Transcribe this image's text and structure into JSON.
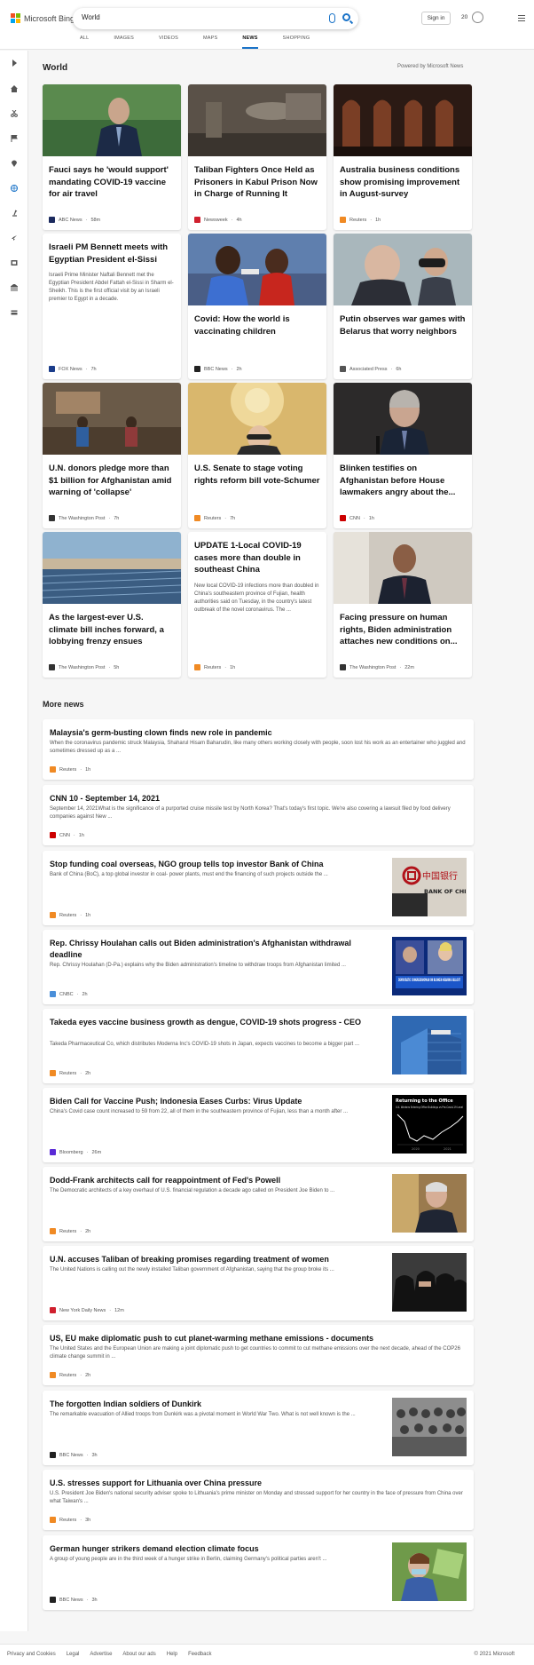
{
  "header": {
    "logo_text": "Microsoft Bing",
    "search_value": "World",
    "signin_label": "Sign in",
    "rewards_count": "20",
    "tabs": [
      "ALL",
      "IMAGES",
      "VIDEOS",
      "MAPS",
      "NEWS",
      "SHOPPING"
    ],
    "active_tab": "NEWS"
  },
  "section": {
    "title": "World",
    "powered_by": "Powered by Microsoft News"
  },
  "cards": [
    {
      "title": "Fauci says he 'would support' mandating COVID-19 vaccine for air travel",
      "desc": "",
      "source": "ABC News",
      "time": "58m",
      "logo_color": "#1b2a5e"
    },
    {
      "title": "Taliban Fighters Once Held as Prisoners in Kabul Prison Now in Charge of Running It",
      "desc": "",
      "source": "Newsweek",
      "time": "4h",
      "logo_color": "#d0202e"
    },
    {
      "title": "Australia business conditions show promising improvement in August-survey",
      "desc": "",
      "source": "Reuters",
      "time": "1h",
      "logo_color": "#f08a24"
    },
    {
      "title": "Israeli PM Bennett meets with Egyptian President el-Sissi",
      "desc": "Israeli Prime Minister Naftali Bennett met the Egyptian President Abdel Fattah el-Sissi in Sharm el-Sheikh. This is the first official visit by an Israeli premier to Egypt in a decade.",
      "source": "FOX News",
      "time": "7h",
      "logo_color": "#1a3c8a"
    },
    {
      "title": "Covid: How the world is vaccinating children",
      "desc": "",
      "source": "BBC News",
      "time": "2h",
      "logo_color": "#222222"
    },
    {
      "title": "Putin observes war games with Belarus that worry neighbors",
      "desc": "",
      "source": "Associated Press",
      "time": "6h",
      "logo_color": "#555555"
    },
    {
      "title": "U.N. donors pledge more than $1 billion for Afghanistan amid warning of 'collapse'",
      "desc": "",
      "source": "The Washington Post",
      "time": "7h",
      "logo_color": "#333333"
    },
    {
      "title": "U.S. Senate to stage voting rights reform bill vote-Schumer",
      "desc": "",
      "source": "Reuters",
      "time": "7h",
      "logo_color": "#f08a24"
    },
    {
      "title": "Blinken testifies on Afghanistan before House lawmakers angry about the...",
      "desc": "",
      "source": "CNN",
      "time": "1h",
      "logo_color": "#cc0000"
    },
    {
      "title": "As the largest-ever U.S. climate bill inches forward, a lobbying frenzy ensues",
      "desc": "",
      "source": "The Washington Post",
      "time": "5h",
      "logo_color": "#333333"
    },
    {
      "title": "UPDATE 1-Local COVID-19 cases more than double in southeast China",
      "desc": "New local COVID-19 infections more than doubled in China's southeastern province of Fujian, health authorities said on Tuesday, in the country's latest outbreak of the novel coronavirus. The ...",
      "source": "Reuters",
      "time": "1h",
      "logo_color": "#f08a24"
    },
    {
      "title": "Facing pressure on human rights, Biden administration attaches new conditions on...",
      "desc": "",
      "source": "The Washington Post",
      "time": "22m",
      "logo_color": "#333333"
    }
  ],
  "more_news": {
    "title": "More news",
    "items": [
      {
        "title": "Malaysia's germ-busting clown finds new role in pandemic",
        "desc": "When the coronavirus pandemic struck Malaysia, Shaharul Hisam Baharudin, like many others working closely with people, soon lost his work as an entertainer who juggled and sometimes dressed up as a ...",
        "source": "Reuters",
        "time": "1h",
        "logo_color": "#f08a24",
        "thumb": ""
      },
      {
        "title": "CNN 10 - September 14, 2021",
        "desc": "September 14, 2021What is the significance of a purported cruise missile test by North Korea? That's today's first topic. We're also covering a lawsuit filed by food delivery companies against New ...",
        "source": "CNN",
        "time": "1h",
        "logo_color": "#cc0000",
        "thumb": ""
      },
      {
        "title": "Stop funding coal overseas, NGO group tells top investor Bank of China",
        "desc": "Bank of China (BoC), a top global investor in coal- power plants, must end the financing of such projects outside the ...",
        "source": "Reuters",
        "time": "1h",
        "logo_color": "#f08a24",
        "thumb": "boc",
        "thumb_cn": "中国银行",
        "thumb_en": "BANK OF CHINA"
      },
      {
        "title": "Rep. Chrissy Houlahan calls out Biden administration's Afghanistan withdrawal deadline",
        "desc": "Rep. Chrissy Houlahan (D-Pa.) explains why the Biden administration's timeline to withdraw troops from Afghanistan limited ...",
        "source": "CNBC",
        "time": "2h",
        "logo_color": "#4a8fd9",
        "thumb": "cnbc",
        "thumb_caption": "DEMOCRATIC CONGRESSWOMAN ON BLINKEN HEARING FALLOUT"
      },
      {
        "title": "Takeda eyes vaccine business growth as dengue, COVID-19 shots progress - CEO",
        "desc": "Takeda Pharmaceutical Co, which distributes Moderna Inc's COVID-19 shots in Japan, expects vaccines to become a bigger part ...",
        "source": "Reuters",
        "time": "2h",
        "logo_color": "#f08a24",
        "thumb": "takeda"
      },
      {
        "title": "Biden Call for Vaccine Push; Indonesia Eases Curbs: Virus Update",
        "desc": "China's Covid case count increased to 59 from 22, all of them in the southeastern province of Fujian, less than a month after ...",
        "source": "Bloomberg",
        "time": "26m",
        "logo_color": "#5a2ad6",
        "thumb": "chart",
        "thumb_title": "Returning to the Office",
        "thumb_sub": "U.K. Workers Entering Office Buildings vs Pre-Covid-19 Level",
        "thumb_years": [
          "2020",
          "2021"
        ]
      },
      {
        "title": "Dodd-Frank architects call for reappointment of Fed's Powell",
        "desc": "The Democratic architects of a key overhaul of U.S. financial regulation a decade ago called on President Joe Biden to ...",
        "source": "Reuters",
        "time": "2h",
        "logo_color": "#f08a24",
        "thumb": "powell"
      },
      {
        "title": "U.N. accuses Taliban of breaking promises regarding treatment of women",
        "desc": "The United Nations is calling out the newly installed Taliban government of Afghanistan, saying that the group broke its ...",
        "source": "New York Daily News",
        "time": "12m",
        "logo_color": "#d0202e",
        "thumb": "taliban"
      },
      {
        "title": "US, EU make diplomatic push to cut planet-warming methane emissions - documents",
        "desc": "The United States and the European Union are making a joint diplomatic push to get countries to commit to cut methane emissions over the next decade, ahead of the COP26 climate change summit in ...",
        "source": "Reuters",
        "time": "2h",
        "logo_color": "#f08a24",
        "thumb": ""
      },
      {
        "title": "The forgotten Indian soldiers of Dunkirk",
        "desc": "The remarkable evacuation of Allied troops from Dunkirk was a pivotal moment in World War Two. What is not well known is the ...",
        "source": "BBC News",
        "time": "3h",
        "logo_color": "#222222",
        "thumb": "dunkirk"
      },
      {
        "title": "U.S. stresses support for Lithuania over China pressure",
        "desc": "U.S. President Joe Biden's national security adviser spoke to Lithuania's prime minister on Monday and stressed support for her country in the face of pressure from China over what Taiwan's ...",
        "source": "Reuters",
        "time": "3h",
        "logo_color": "#f08a24",
        "thumb": ""
      },
      {
        "title": "German hunger strikers demand election climate focus",
        "desc": "A group of young people are in the third week of a hunger strike in Berlin, claiming Germany's political parties aren't ...",
        "source": "BBC News",
        "time": "3h",
        "logo_color": "#222222",
        "thumb": "hunger"
      }
    ]
  },
  "footer": {
    "links": [
      "Privacy and Cookies",
      "Legal",
      "Advertise",
      "About our ads",
      "Help",
      "Feedback"
    ],
    "copyright": "© 2021 Microsoft"
  }
}
